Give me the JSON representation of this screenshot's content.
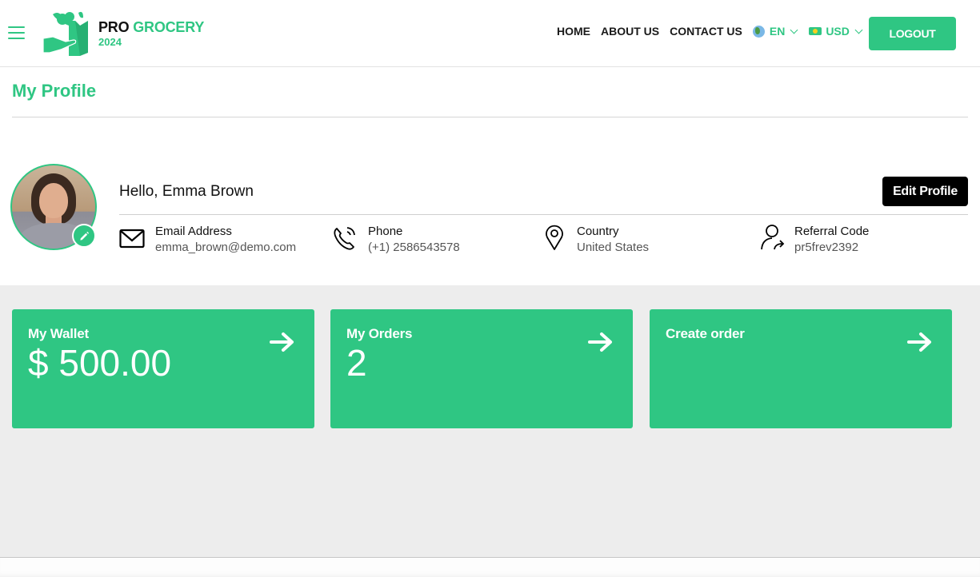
{
  "header": {
    "brand_pro": "PRO",
    "brand_grocery": "GROCERY",
    "brand_year": "2024",
    "nav": [
      "HOME",
      "ABOUT US",
      "CONTACT US"
    ],
    "language": "EN",
    "currency": "USD",
    "logout_label": "LOGOUT"
  },
  "page": {
    "title": "My Profile"
  },
  "profile": {
    "greeting": "Hello, Emma Brown",
    "edit_label": "Edit Profile",
    "fields": [
      {
        "label": "Email Address",
        "value": "emma_brown@demo.com",
        "icon": "envelope-icon"
      },
      {
        "label": "Phone",
        "value": "(+1) 2586543578",
        "icon": "phone-icon"
      },
      {
        "label": "Country",
        "value": "United States",
        "icon": "map-pin-icon"
      },
      {
        "label": "Referral Code",
        "value": "pr5frev2392",
        "icon": "user-share-icon"
      }
    ]
  },
  "cards": [
    {
      "title": "My Wallet",
      "value": "$ 500.00"
    },
    {
      "title": "My Orders",
      "value": "2"
    },
    {
      "title": "Create order",
      "value": ""
    }
  ],
  "colors": {
    "brand_green": "#2fc683",
    "dark_button": "#000000",
    "grey_background": "#ededed"
  }
}
